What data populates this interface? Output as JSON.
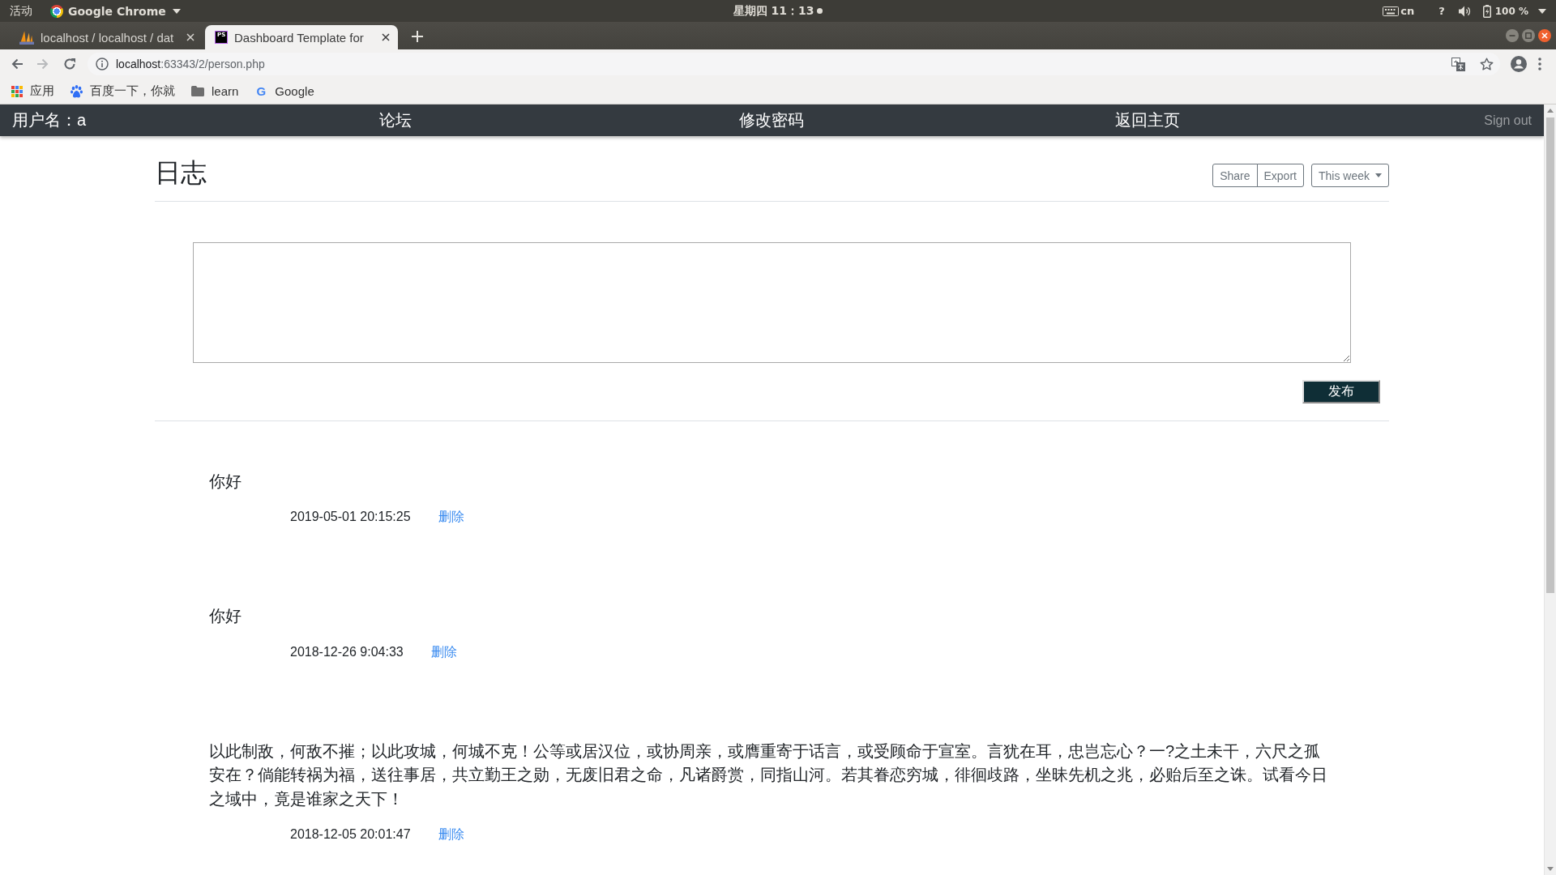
{
  "system_bar": {
    "activities": "活动",
    "app_menu": "Google Chrome",
    "clock": "星期四 11：13",
    "input_method": "cn",
    "status_mark": "?",
    "battery": "100 %"
  },
  "browser": {
    "tabs": [
      {
        "title": "localhost / localhost / dat",
        "selected": false,
        "kind": "sails"
      },
      {
        "title": "Dashboard Template for",
        "selected": true,
        "kind": "letters",
        "icon_text": "PS"
      }
    ],
    "back_disabled": false,
    "forward_disabled": true,
    "url": {
      "host": "localhost",
      "rest": ":63343/2/person.php"
    },
    "bookmarks": [
      {
        "label": "应用",
        "kind": "apps"
      },
      {
        "label": "百度一下，你就",
        "kind": "paw"
      },
      {
        "label": "learn",
        "kind": "folder"
      },
      {
        "label": "Google",
        "kind": "letter",
        "icon_text": "G"
      }
    ]
  },
  "navbar": {
    "user": "用户名：a",
    "links": [
      "论坛",
      "修改密码",
      "返回主页"
    ],
    "sign_out": "Sign out"
  },
  "header": {
    "title": "日志",
    "button_group": [
      "Share",
      "Export"
    ],
    "range_dropdown": "This week"
  },
  "composer": {
    "submit": "发布"
  },
  "posts": [
    {
      "content": "你好",
      "time": "2019-05-01 20:15:25",
      "action": "删除"
    },
    {
      "content": "你好",
      "time": "2018-12-26 9:04:33",
      "action": "删除"
    },
    {
      "content": "以此制敌，何敌不摧；以此攻城，何城不克！公等或居汉位，或协周亲，或膺重寄于话言，或受顾命于宣室。言犹在耳，忠岂忘心？一?之土未干，六尺之孤安在？倘能转祸为福，送往事居，共立勤王之勋，无废旧君之命，凡诸爵赏，同指山河。若其眷恋穷城，徘徊歧路，坐昧先机之兆，必贻后至之诛。试看今日之域中，竟是谁家之天下！",
      "time": "2018-12-05 20:01:47",
      "action": "删除"
    }
  ]
}
